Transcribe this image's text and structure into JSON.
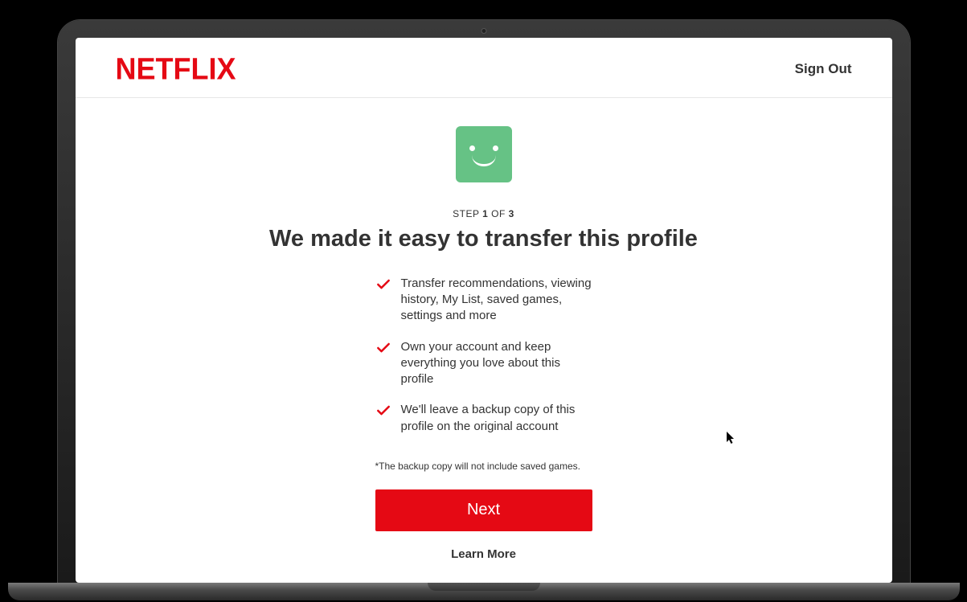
{
  "header": {
    "logo": "NETFLIX",
    "sign_out": "Sign Out"
  },
  "step": {
    "prefix": "STEP",
    "current": "1",
    "of": "OF",
    "total": "3"
  },
  "headline": "We made it easy to transfer this profile",
  "benefits": [
    "Transfer recommendations, viewing history, My List, saved games, settings and more",
    "Own your account and keep everything you love about this profile",
    "We'll leave a backup copy of this profile on the original account"
  ],
  "footnote": "*The backup copy will not include saved games.",
  "actions": {
    "next": "Next",
    "learn_more": "Learn More"
  },
  "colors": {
    "brand": "#e50914",
    "avatar": "#66c285"
  }
}
